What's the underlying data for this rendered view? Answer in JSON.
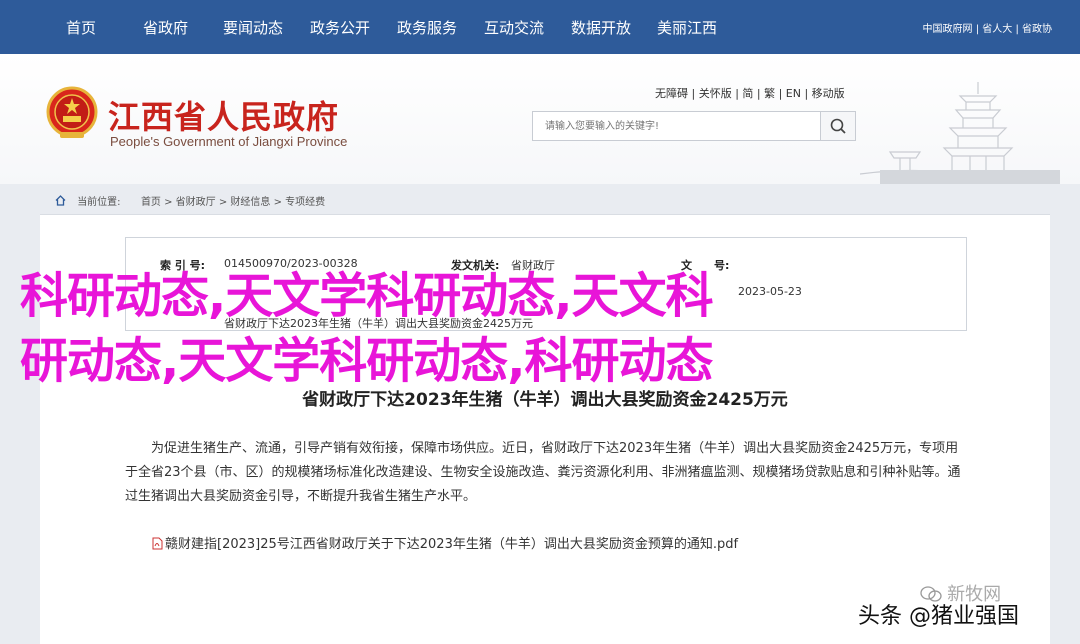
{
  "nav": {
    "items": [
      "首页",
      "省政府",
      "要闻动态",
      "政务公开",
      "政务服务",
      "互动交流",
      "数据开放",
      "美丽江西"
    ],
    "util": "中国政府网 | 省人大 | 省政协"
  },
  "header": {
    "title": "江西省人民政府",
    "subtitle": "People's Government of Jiangxi Province",
    "links": "无障碍 | 关怀版 | 简 | 繁 | EN | 移动版",
    "search_placeholder": "请输入您要输入的关键字!"
  },
  "breadcrumb": {
    "label": "当前位置:",
    "path": "首页 > 省财政厅 > 财经信息 > 专项经费"
  },
  "meta": {
    "index_label": "索 引 号:",
    "index_value": "014500970/2023-00328",
    "issuer_label": "发文机关:",
    "issuer_value": "省财政厅",
    "docno_label": "文　　号:",
    "date_value": "2023-05-23",
    "title_value": "省财政厅下达2023年生猪（牛羊）调出大县奖励资金2425万元"
  },
  "article": {
    "title": "省财政厅下达2023年生猪（牛羊）调出大县奖励资金2425万元",
    "body": "为促进生猪生产、流通，引导产销有效衔接，保障市场供应。近日，省财政厅下达2023年生猪（牛羊）调出大县奖励资金2425万元，专项用于全省23个县（市、区）的规模猪场标准化改造建设、生物安全设施改造、粪污资源化利用、非洲猪瘟监测、规模猪场贷款贴息和引种补贴等。通过生猪调出大县奖励资金引导，不断提升我省生猪生产水平。",
    "attachment": "赣财建指[2023]25号江西省财政厅关于下达2023年生猪（牛羊）调出大县奖励资金预算的通知.pdf"
  },
  "overlay": {
    "line1": "科研动态,天文学科研动态,天文科",
    "line2": "研动态,天文学科研动态,科研动态"
  },
  "watermarks": {
    "source": "新牧网",
    "toutiao": "头条 @猪业强国"
  },
  "colors": {
    "nav_bg": "#2e5b9a",
    "title_red": "#c8241d",
    "overlay_magenta": "#e815d8"
  }
}
